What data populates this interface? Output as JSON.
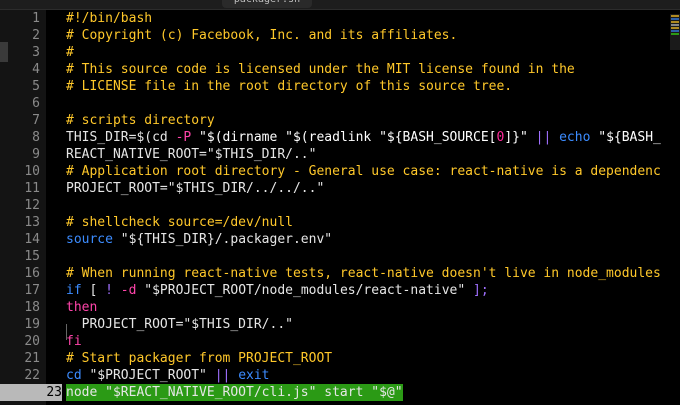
{
  "tab": {
    "label": "packager.sh"
  },
  "editor": {
    "current_line": 23,
    "lines": [
      {
        "n": "1",
        "tokens": [
          {
            "t": "#!/bin/bash",
            "c": "cm"
          }
        ]
      },
      {
        "n": "2",
        "tokens": [
          {
            "t": "# Copyright (c) Facebook, Inc. and its affiliates.",
            "c": "cm"
          }
        ]
      },
      {
        "n": "3",
        "tokens": [
          {
            "t": "#",
            "c": "cm"
          }
        ]
      },
      {
        "n": "4",
        "tokens": [
          {
            "t": "# This source code is licensed under the MIT license found in the",
            "c": "cm"
          }
        ]
      },
      {
        "n": "5",
        "tokens": [
          {
            "t": "# LICENSE file in the root directory of this source tree.",
            "c": "cm"
          }
        ]
      },
      {
        "n": "6",
        "tokens": []
      },
      {
        "n": "7",
        "tokens": [
          {
            "t": "# scripts directory",
            "c": "cm"
          }
        ]
      },
      {
        "n": "8",
        "tokens": [
          {
            "t": "THIS_DIR=$(cd ",
            "c": ""
          },
          {
            "t": "-P",
            "c": "pink"
          },
          {
            "t": " \"$(dirname \"$(readlink \"${BASH_SOURCE[",
            "c": "str"
          },
          {
            "t": "0",
            "c": "num"
          },
          {
            "t": "]}\" ",
            "c": "str"
          },
          {
            "t": "||",
            "c": "op"
          },
          {
            "t": " echo ",
            "c": "kw"
          },
          {
            "t": "\"${BASH_",
            "c": "str"
          }
        ]
      },
      {
        "n": "9",
        "tokens": [
          {
            "t": "REACT_NATIVE_ROOT=\"$THIS_DIR/..\"",
            "c": ""
          }
        ]
      },
      {
        "n": "10",
        "tokens": [
          {
            "t": "# Application root directory - General use case: react-native is a dependenc",
            "c": "cm"
          }
        ]
      },
      {
        "n": "11",
        "tokens": [
          {
            "t": "PROJECT_ROOT=\"$THIS_DIR/../../..\"",
            "c": ""
          }
        ]
      },
      {
        "n": "12",
        "tokens": []
      },
      {
        "n": "13",
        "tokens": [
          {
            "t": "# shellcheck source=/dev/null",
            "c": "cm"
          }
        ]
      },
      {
        "n": "14",
        "tokens": [
          {
            "t": "source",
            "c": "kw"
          },
          {
            "t": " \"${THIS_DIR}/.packager.env\"",
            "c": ""
          }
        ]
      },
      {
        "n": "15",
        "tokens": []
      },
      {
        "n": "16",
        "tokens": [
          {
            "t": "# When running react-native tests, react-native doesn't live in node_modules",
            "c": "cm"
          }
        ]
      },
      {
        "n": "17",
        "tokens": [
          {
            "t": "if",
            "c": "kw"
          },
          {
            "t": " [ ",
            "c": ""
          },
          {
            "t": "!",
            "c": "op"
          },
          {
            "t": " ",
            "c": ""
          },
          {
            "t": "-d",
            "c": "pink"
          },
          {
            "t": " \"$PROJECT_ROOT/node_modules/react-native\" ",
            "c": ""
          },
          {
            "t": "];",
            "c": "op"
          }
        ]
      },
      {
        "n": "18",
        "tokens": [
          {
            "t": "then",
            "c": "pink"
          }
        ]
      },
      {
        "n": "19",
        "tokens": [
          {
            "t": "  PROJECT_ROOT=\"$THIS_DIR/..\"",
            "c": ""
          }
        ]
      },
      {
        "n": "20",
        "tokens": [
          {
            "t": "fi",
            "c": "pink"
          }
        ]
      },
      {
        "n": "21",
        "tokens": [
          {
            "t": "# Start packager from PROJECT_ROOT",
            "c": "cm"
          }
        ]
      },
      {
        "n": "22",
        "tokens": [
          {
            "t": "cd",
            "c": "kw"
          },
          {
            "t": " \"$PROJECT_ROOT\" ",
            "c": ""
          },
          {
            "t": "||",
            "c": "op"
          },
          {
            "t": " exit",
            "c": "kw"
          }
        ]
      },
      {
        "n": "23",
        "tokens": [
          {
            "t": "node \"$REACT_NATIVE_ROOT/cli.js\" start \"$@\"",
            "c": ""
          }
        ]
      }
    ]
  },
  "colors": {
    "comment": "#ffc82a",
    "keyword": "#3c8cff",
    "flag": "#ff44aa",
    "operator": "#a070ff",
    "current_line": "#2b9a15",
    "background": "#000000"
  }
}
